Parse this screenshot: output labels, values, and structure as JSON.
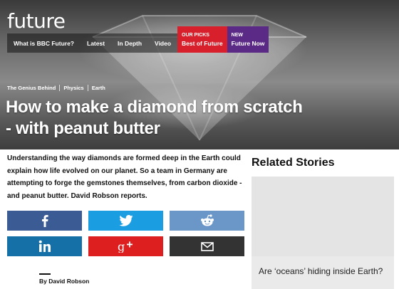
{
  "header": {
    "logo": "future"
  },
  "nav": {
    "items": [
      "What is BBC Future?",
      "Latest",
      "In Depth",
      "Video"
    ],
    "our_picks": {
      "tag": "OUR PICKS",
      "label": "Best of Future"
    },
    "new": {
      "tag": "NEW",
      "label": "Future Now"
    }
  },
  "breadcrumbs": [
    "The Genius Behind",
    "Physics",
    "Earth"
  ],
  "article": {
    "title": "How to make a diamond from scratch - with peanut butter",
    "summary": "Understanding the way diamonds are formed deep in the Earth could explain how life evolved on our planet. So a team in Germany are attempting to forge the gemstones themselves, from carbon dioxide - and peanut butter. David Robson reports.",
    "byline": "By David Robson"
  },
  "share": {
    "icons": [
      "facebook-icon",
      "twitter-icon",
      "reddit-icon",
      "linkedin-icon",
      "google-plus-icon",
      "email-icon"
    ]
  },
  "related": {
    "heading": "Related Stories",
    "items": [
      {
        "title": "Are ‘oceans’ hiding inside Earth?"
      }
    ]
  },
  "colors": {
    "our_picks": "#d7202b",
    "future_now": "#5b2a86",
    "facebook": "#3b5b95",
    "twitter": "#1b9de2",
    "reddit": "#6a97c8",
    "linkedin": "#1670a8",
    "google_plus": "#dd1f1f",
    "email": "#333333"
  }
}
